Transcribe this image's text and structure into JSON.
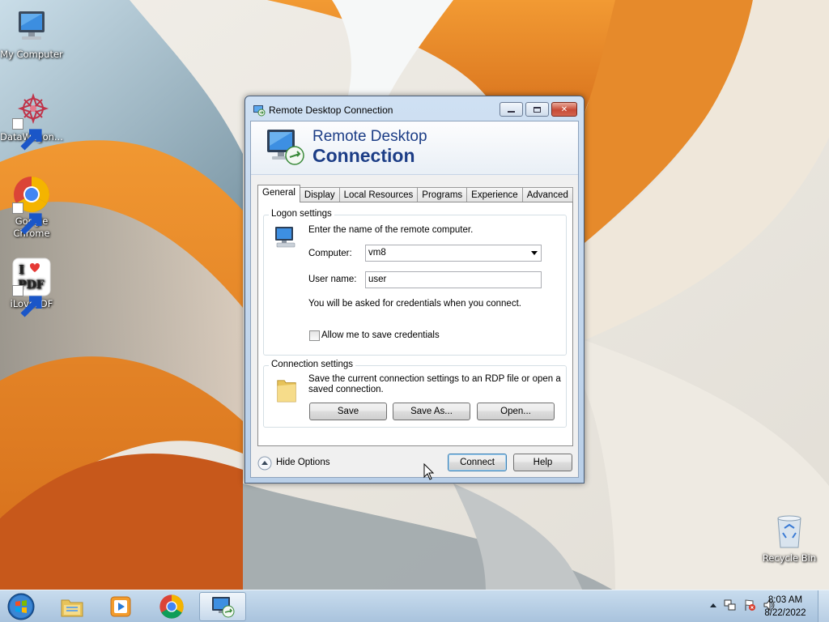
{
  "desktop": {
    "icons": [
      {
        "label": "My Computer",
        "icon": "computer-icon"
      },
      {
        "label": "DataWagon...",
        "icon": "datawagon-icon"
      },
      {
        "label": "Google Chrome",
        "icon": "chrome-icon"
      },
      {
        "label": "iLovePDF",
        "icon": "ilovepdf-icon"
      },
      {
        "label": "Recycle Bin",
        "icon": "recycle-bin-icon"
      }
    ]
  },
  "window": {
    "title": "Remote Desktop Connection",
    "banner_line1": "Remote Desktop",
    "banner_line2": "Connection",
    "tabs": [
      {
        "label": "General",
        "active": true
      },
      {
        "label": "Display"
      },
      {
        "label": "Local Resources"
      },
      {
        "label": "Programs"
      },
      {
        "label": "Experience"
      },
      {
        "label": "Advanced"
      }
    ],
    "logon": {
      "group_label": "Logon settings",
      "instruction": "Enter the name of the remote computer.",
      "computer_label": "Computer:",
      "computer_value": "vm8",
      "username_label": "User name:",
      "username_value": "user",
      "credentials_note": "You will be asked for credentials when you connect.",
      "save_credentials_label": "Allow me to save credentials",
      "save_credentials_checked": false
    },
    "connection": {
      "group_label": "Connection settings",
      "description_line1": "Save the current connection settings to an RDP file or open a",
      "description_line2": "saved connection.",
      "save_label": "Save",
      "save_as_label": "Save As...",
      "open_label": "Open..."
    },
    "footer": {
      "hide_options_label": "Hide Options",
      "connect_label": "Connect",
      "help_label": "Help"
    }
  },
  "taskbar": {
    "pinned": [
      "windows-explorer-icon",
      "media-player-icon",
      "chrome-icon",
      "remote-desktop-icon"
    ],
    "clock_time": "8:03 AM",
    "clock_date": "8/22/2022"
  },
  "colors": {
    "banner_text": "#1c3d86",
    "wallpaper_orange": "#e98a2a",
    "taskbar": "#b7cfe6"
  }
}
